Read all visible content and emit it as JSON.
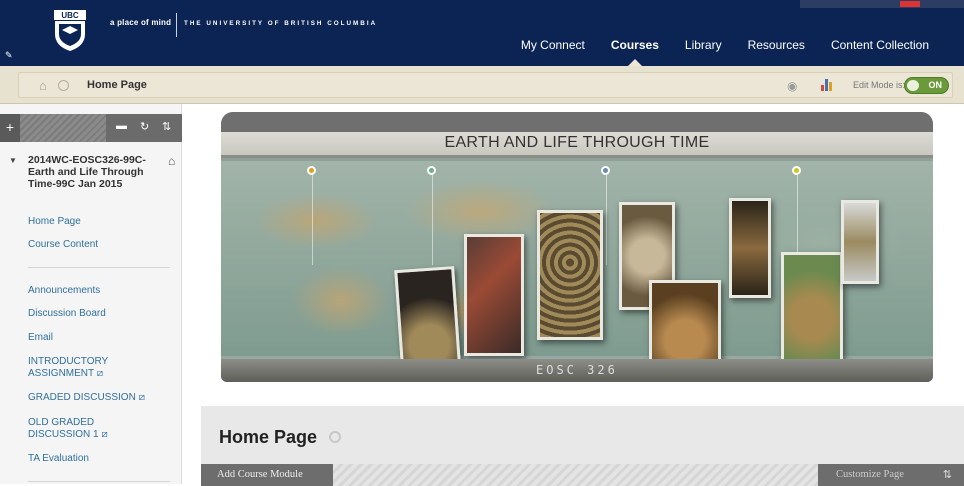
{
  "header": {
    "tagline": "a place of mind",
    "university": "THE UNIVERSITY OF BRITISH COLUMBIA",
    "nav": [
      "My Connect",
      "Courses",
      "Library",
      "Resources",
      "Content Collection"
    ],
    "active_nav": "Courses",
    "brand_color": "#0b2453"
  },
  "breadcrumb": {
    "label": "Home Page",
    "edit_mode_label": "Edit Mode is:",
    "edit_mode_state": "ON"
  },
  "sidebar": {
    "course_title": "2014WC-EOSC326-99C-Earth and Life Through Time-99C Jan 2015",
    "group1": [
      "Home Page",
      "Course Content"
    ],
    "group2": [
      "Announcements",
      "Discussion Board",
      "Email",
      "INTRODUCTORY ASSIGNMENT ⧄",
      "GRADED DISCUSSION ⧄",
      "OLD GRADED DISCUSSION 1 ⧄",
      "TA Evaluation"
    ],
    "link_color": "#2f6f9f"
  },
  "banner": {
    "title": "EARTH AND LIFE THROUGH TIME",
    "code": "EOSC 326"
  },
  "main": {
    "page_title": "Home Page",
    "add_button": "Add Course Module",
    "customize_button": "Customize Page"
  }
}
